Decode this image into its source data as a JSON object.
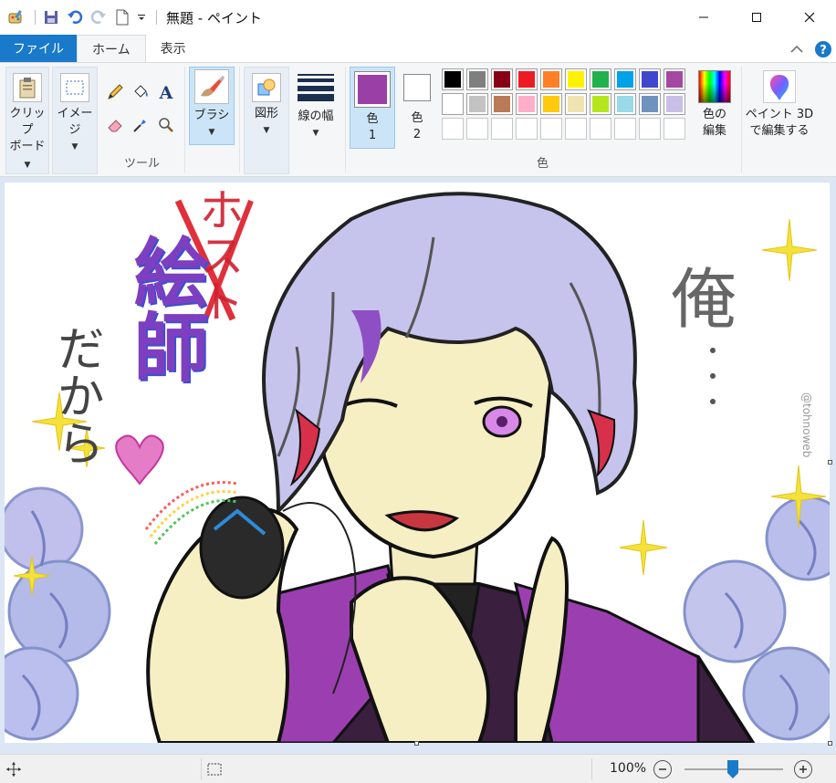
{
  "window": {
    "title": "無題 - ペイント",
    "minimize_icon": "minimize-icon",
    "maximize_icon": "maximize-icon",
    "close_icon": "close-icon"
  },
  "tabs": {
    "file": "ファイル",
    "home": "ホーム",
    "view": "表示"
  },
  "ribbon": {
    "clipboard": {
      "line1": "クリップ",
      "line2": "ボード"
    },
    "image": {
      "label": "イメージ"
    },
    "tools": {
      "group_label": "ツール"
    },
    "brush": {
      "label": "ブラシ"
    },
    "shapes": {
      "label": "図形"
    },
    "size": {
      "label": "線の幅"
    },
    "color1": {
      "line1": "色",
      "line2": "1",
      "value": "#9a3fa6"
    },
    "color2": {
      "line1": "色",
      "line2": "2",
      "value": "#ffffff"
    },
    "colors_group_label": "色",
    "edit_colors": {
      "line1": "色の",
      "line2": "編集"
    },
    "paint3d": {
      "line1": "ペイント 3D",
      "line2": "で編集する"
    },
    "palette_row1": [
      "#000000",
      "#7f7f7f",
      "#880015",
      "#ed1c24",
      "#ff7f27",
      "#fff200",
      "#22b14c",
      "#00a2e8",
      "#3f48cc",
      "#a349a4"
    ],
    "palette_row2": [
      "#ffffff",
      "#c3c3c3",
      "#b97a57",
      "#ffaec9",
      "#ffc90e",
      "#efe4b0",
      "#b5e61d",
      "#99d9ea",
      "#7092be",
      "#c8bfe7"
    ]
  },
  "canvas": {
    "text_eshi": "絵師",
    "text_dakara": "だから",
    "text_crossed": "ホスト",
    "text_ore": "俺",
    "text_dots": "・・・",
    "signature": "@tohnoweb"
  },
  "status": {
    "zoom": "100%",
    "zoom_level": 1.0
  }
}
